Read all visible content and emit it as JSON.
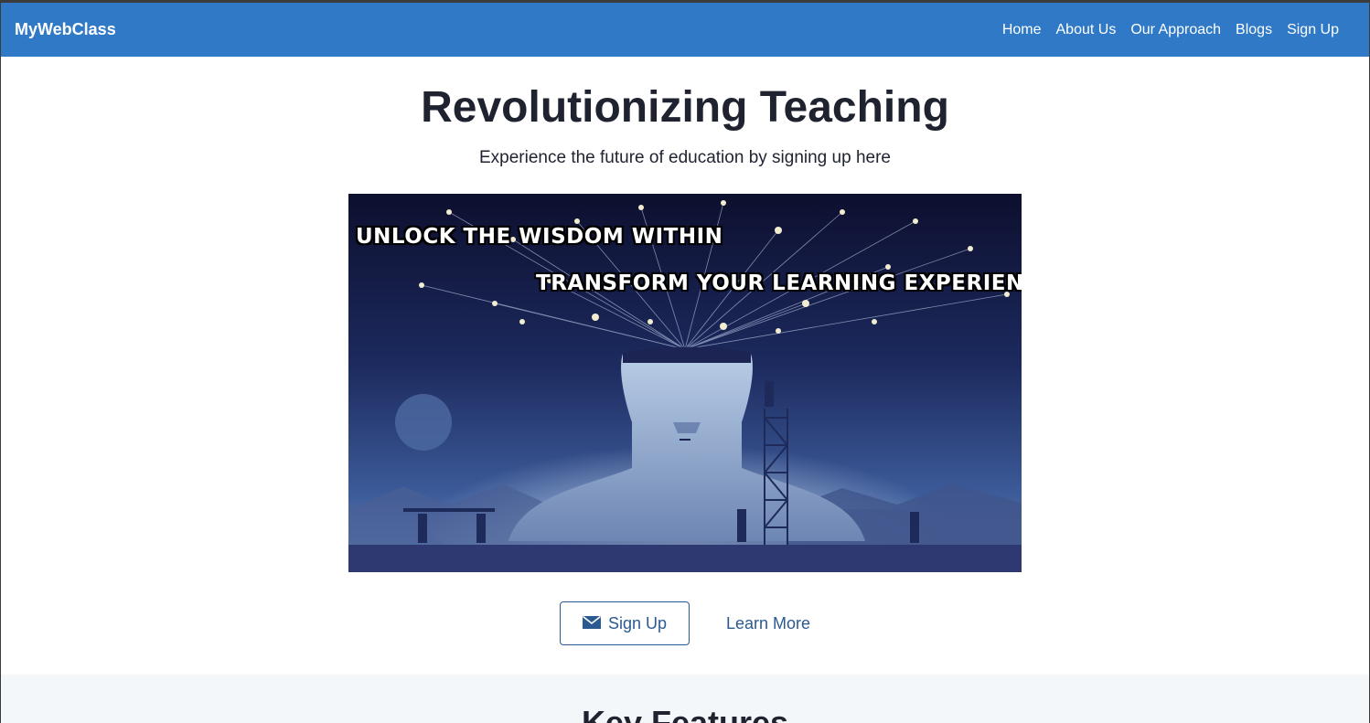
{
  "nav": {
    "brand": "MyWebClass",
    "links": [
      "Home",
      "About Us",
      "Our Approach",
      "Blogs",
      "Sign Up"
    ]
  },
  "hero": {
    "title": "Revolutionizing Teaching",
    "subtitle": "Experience the future of education by signing up here",
    "image": {
      "caption_1": "UNLOCK THE WISDOM WITHIN",
      "caption_2": "TRANSFORM YOUR LEARNING  EXPERIENCE"
    },
    "signup_label": "Sign Up",
    "signup_icon": "envelope-icon",
    "learn_more_label": "Learn More"
  },
  "features": {
    "title": "Key Features"
  },
  "colors": {
    "navbar": "#2f79c7",
    "link": "#2b5a92",
    "text": "#1f2330",
    "features_bg": "#f4f7fa"
  }
}
